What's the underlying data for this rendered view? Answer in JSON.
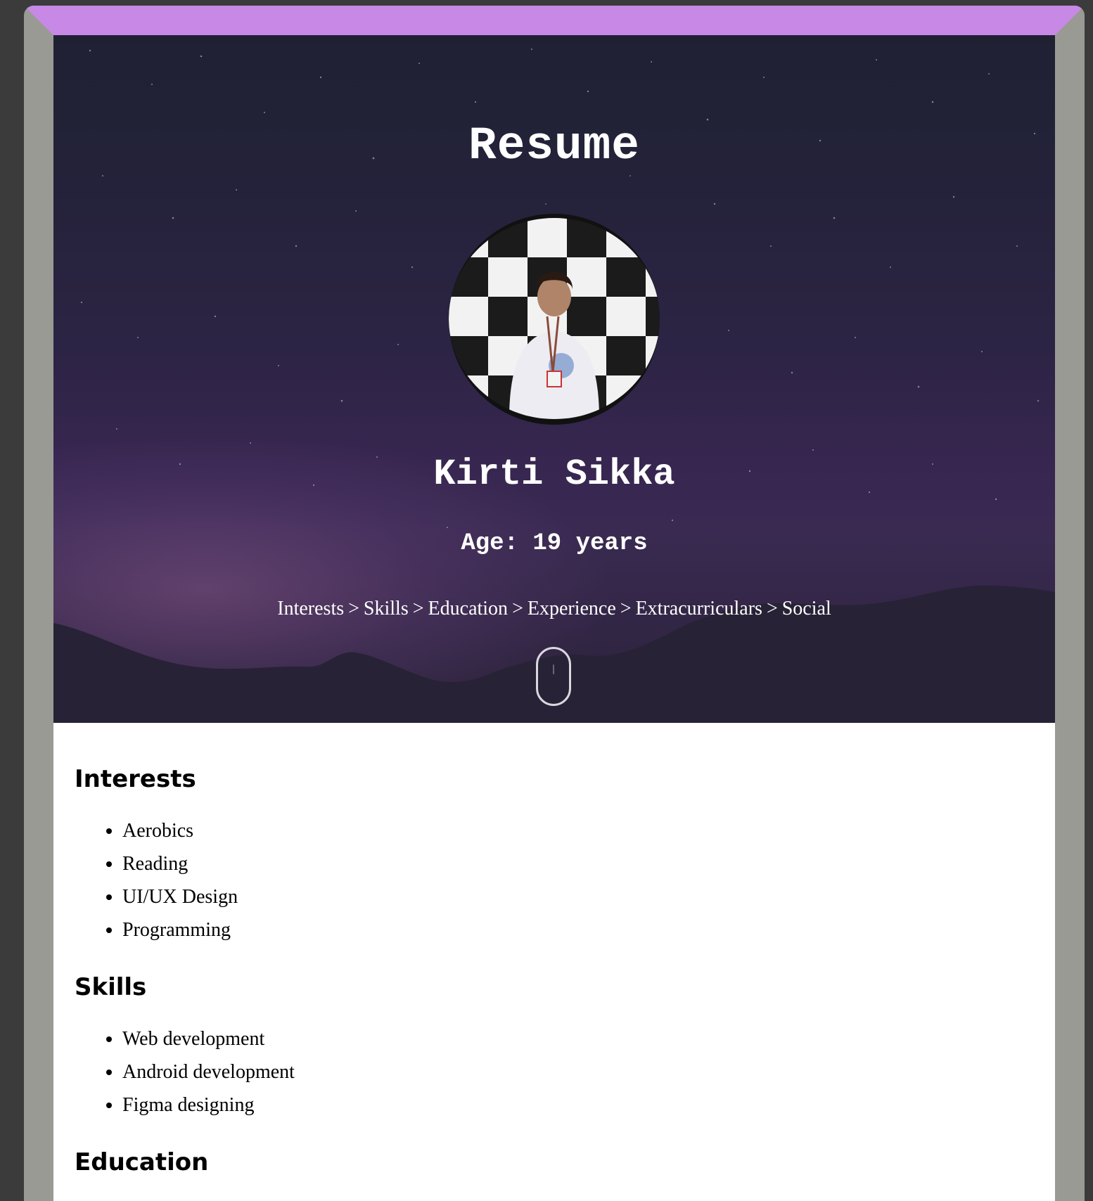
{
  "hero": {
    "title": "Resume",
    "name": "Kirti Sikka",
    "age": "Age: 19 years",
    "nav": [
      {
        "label": "Interests"
      },
      {
        "label": "Skills"
      },
      {
        "label": "Education"
      },
      {
        "label": "Experience"
      },
      {
        "label": "Extracurriculars"
      },
      {
        "label": "Social"
      }
    ],
    "separator": ">"
  },
  "sections": {
    "interests": {
      "title": "Interests",
      "items": [
        "Aerobics",
        "Reading",
        "UI/UX Design",
        "Programming"
      ]
    },
    "skills": {
      "title": "Skills",
      "items": [
        "Web development",
        "Android development",
        "Figma designing"
      ]
    },
    "education": {
      "title": "Education"
    }
  },
  "colors": {
    "frame_top": "#c888e6",
    "frame_side": "#9a9a94",
    "hero_bg": "#24223a"
  }
}
